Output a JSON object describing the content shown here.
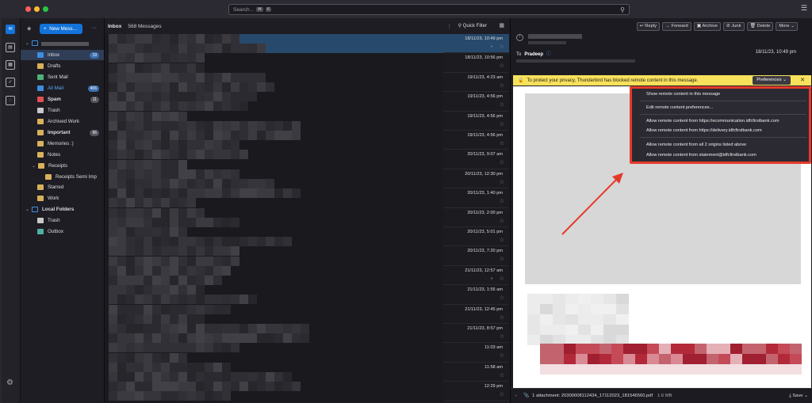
{
  "search": {
    "placeholder": "Search...",
    "keys": [
      "⌘",
      "K"
    ]
  },
  "folder_pane": {
    "new_message": "New Mess...",
    "folders": [
      {
        "name": "Inbox",
        "badge": "19",
        "selected": true,
        "color": "#3c8fe0"
      },
      {
        "name": "Drafts",
        "color": "#d9b15b"
      },
      {
        "name": "Sent Mail",
        "color": "#4fb07a"
      },
      {
        "name": "All Mail",
        "badge": "406",
        "color": "#3c8fe0",
        "blue_text": true
      },
      {
        "name": "Spam",
        "badge": "11",
        "color": "#e05050",
        "bold": true
      },
      {
        "name": "Trash",
        "color": "#c8c8c8"
      },
      {
        "name": "Archived Work",
        "color": "#d9b15b"
      },
      {
        "name": "Important",
        "badge": "96",
        "color": "#d9b15b",
        "bold": true
      },
      {
        "name": "Memories :)",
        "color": "#d9b15b"
      },
      {
        "name": "Notes",
        "color": "#d9b15b"
      },
      {
        "name": "Receipts",
        "color": "#d9b15b"
      },
      {
        "name": "Receipts Semi Imp",
        "color": "#d9b15b"
      },
      {
        "name": "Starred",
        "color": "#d9b15b"
      },
      {
        "name": "Work",
        "color": "#d9b15b"
      }
    ],
    "local_folders": {
      "label": "Local Folders",
      "items": [
        "Trash",
        "Outbox"
      ]
    }
  },
  "message_list": {
    "title": "Inbox",
    "count": "568 Messages",
    "quick_filter": "Quick Filter",
    "dates": [
      "18/11/23, 10:49 pm",
      "18/11/23, 10:56 pm",
      "19/11/23, 4:23 am",
      "19/11/23, 4:56 pm",
      "19/11/23, 4:56 pm",
      "19/11/23, 4:56 pm",
      "20/11/23, 9:07 am",
      "20/11/23, 12:30 pm",
      "20/11/23, 1:40 pm",
      "20/11/23, 2:00 pm",
      "20/11/23, 5:01 pm",
      "20/11/23, 7:20 pm",
      "21/11/23, 12:57 am",
      "21/11/23, 1:55 am",
      "21/11/23, 12:45 pm",
      "21/11/23, 8:57 pm",
      "11:03 am",
      "11:58 am",
      "12:29 pm"
    ]
  },
  "reader": {
    "buttons": [
      "Reply",
      "Forward",
      "Archive",
      "Junk",
      "Delete",
      "More"
    ],
    "to_label": "To",
    "to_name": "Pradeep",
    "date": "18/11/23, 10:49 pm",
    "notification": "To protect your privacy, Thunderbird has blocked remote content in this message.",
    "preferences": "Preferences",
    "attachment": "1 attachment: 20300008112434_17112023_181546560.pdf",
    "attachment_size": "1.6 MB",
    "save": "Save"
  },
  "dropdown": {
    "items": [
      "Show remote content in this message",
      "Edit remote content preferences...",
      "Allow remote content from https://ecommunication.idfcfirstbank.com",
      "Allow remote content from https://delivery.idfcfirstbank.com",
      "Allow remote content from all 2 origins listed above",
      "Allow remote content from statement@idfcfirstbank.com"
    ]
  }
}
